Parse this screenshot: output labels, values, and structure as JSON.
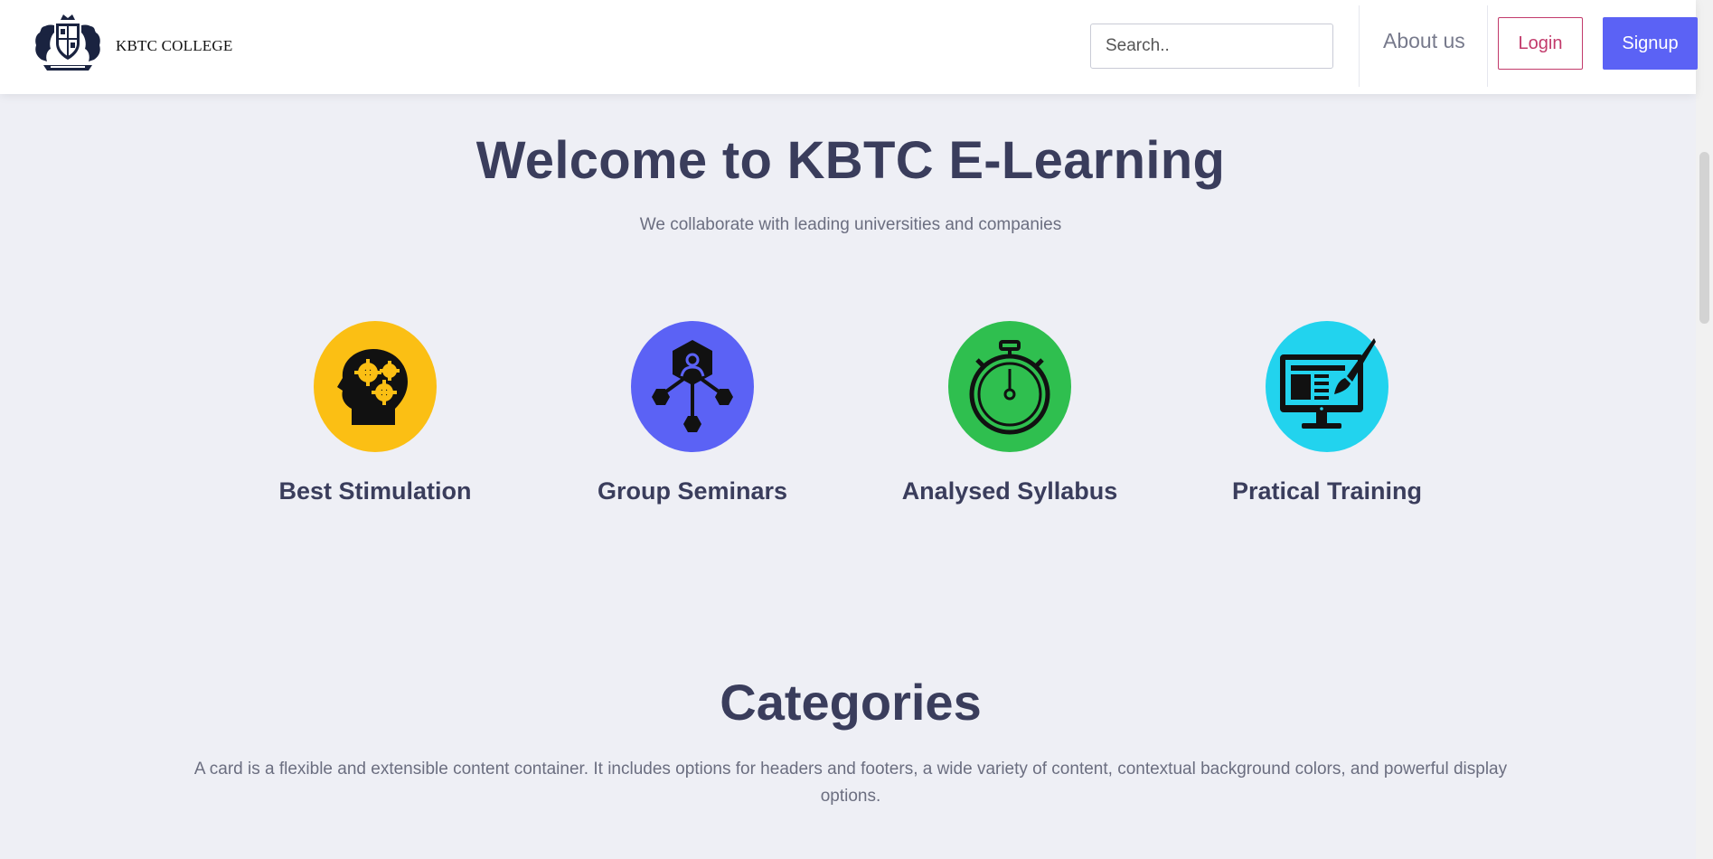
{
  "navbar": {
    "brand_name": "KBTC COLLEGE",
    "search_placeholder": "Search..",
    "about_label": "About us",
    "login_label": "Login",
    "signup_label": "Signup"
  },
  "hero": {
    "title": "Welcome to KBTC E-Learning",
    "subtitle": "We collaborate with leading universities and companies"
  },
  "features": [
    {
      "label": "Best Stimulation",
      "icon": "brain-gears-icon",
      "color": "#fbbf14"
    },
    {
      "label": "Group Seminars",
      "icon": "network-nodes-icon",
      "color": "#5b62f5"
    },
    {
      "label": "Analysed Syllabus",
      "icon": "stopwatch-icon",
      "color": "#2fbf4f"
    },
    {
      "label": "Pratical Training",
      "icon": "monitor-brush-icon",
      "color": "#22d3ee"
    }
  ],
  "categories": {
    "title": "Categories",
    "description": "A card is a flexible and extensible content container. It includes options for headers and footers, a wide variety of content, contextual background colors, and powerful display options."
  },
  "colors": {
    "accent": "#5b62f5",
    "login": "#c23a6b",
    "background": "#eeeff5"
  }
}
